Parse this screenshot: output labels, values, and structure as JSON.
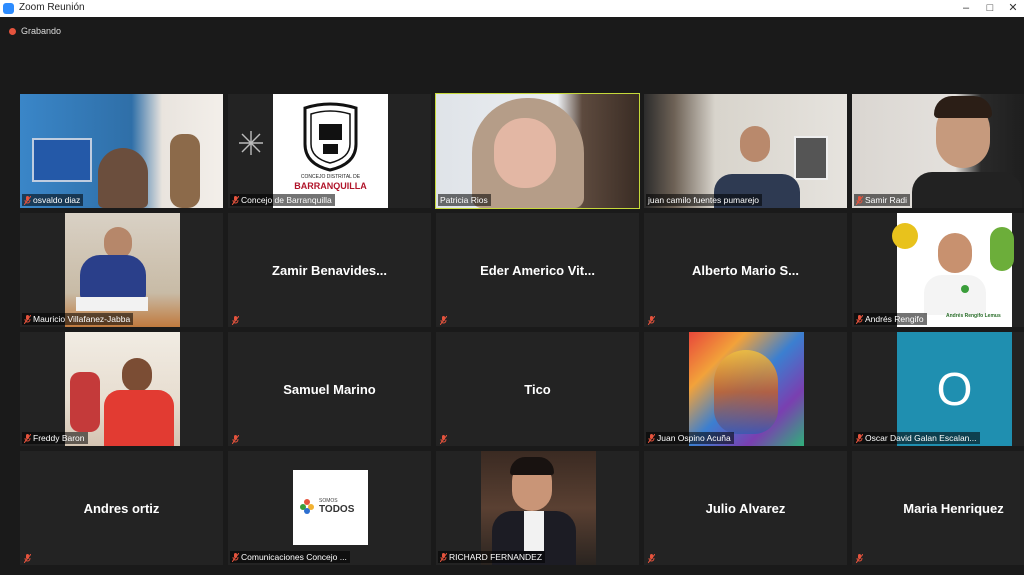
{
  "window": {
    "title": "Zoom Reunión"
  },
  "recording": {
    "label": "Grabando"
  },
  "tiles": [
    {
      "name": "osvaldo diaz"
    },
    {
      "name": "Concejo de Barranquilla"
    },
    {
      "name": "Patricia Rios"
    },
    {
      "name": "juan camilo fuentes pumarejo"
    },
    {
      "name": "Samir Radi"
    },
    {
      "name": "Mauricio Villafanez-Jabba"
    },
    {
      "name": "Zamir Benavides..."
    },
    {
      "name": "Eder Americo Vit..."
    },
    {
      "name": "Alberto Mario S..."
    },
    {
      "name": "Andrés Rengifo",
      "overlay_text": "Andrés Rengifo Lemus"
    },
    {
      "name": "Freddy Baron"
    },
    {
      "name": "Samuel Marino"
    },
    {
      "name": "Tico"
    },
    {
      "name": "Juan Ospino Acuña"
    },
    {
      "name": "Oscar David Galan Escalan...",
      "avatar_letter": "O"
    },
    {
      "name": "Andres ortiz"
    },
    {
      "name": "Comunicaciones Concejo ...",
      "logo_text": {
        "line1": "SOMOS",
        "line2": "TODOS"
      }
    },
    {
      "name": "RICHARD FERNANDEZ"
    },
    {
      "name": "Julio Alvarez"
    },
    {
      "name": "Maria Henriquez"
    }
  ],
  "concejo_logo": {
    "top": "CONCEJO DISTRITAL DE",
    "main": "BARRANQUILLA"
  },
  "colors": {
    "active_border": "#c6d83a",
    "muted_mic": "#e5533d",
    "avatar_bg": "#1f8fb0"
  }
}
